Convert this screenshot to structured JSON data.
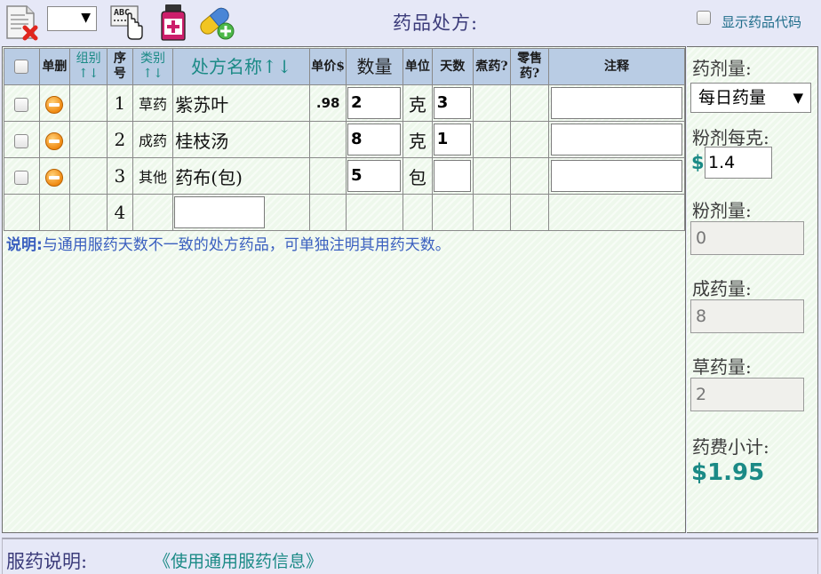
{
  "toolbar": {
    "select_value": "",
    "title": "药品处方:",
    "show_code_label": "显示药品代码",
    "icons": [
      "clear-prescription-icon",
      "spell-check-icon",
      "medicine-bottle-icon",
      "add-capsule-icon"
    ]
  },
  "table": {
    "headers": {
      "delete": "单删",
      "group": "组别↑↓",
      "seq": "序号",
      "category": "类别↑↓",
      "name": "处方名称↑↓",
      "price": "单价$",
      "qty": "数量",
      "unit": "单位",
      "days": "天数",
      "decoct": "煮药?",
      "retail": "零售药?",
      "notes": "注释"
    },
    "rows": [
      {
        "seq": "1",
        "category": "草药",
        "name": "紫苏叶",
        "price": ".98",
        "qty": "2",
        "unit": "克",
        "days": "3",
        "note": ""
      },
      {
        "seq": "2",
        "category": "成药",
        "name": "桂枝汤",
        "price": "",
        "qty": "8",
        "unit": "克",
        "days": "1",
        "note": ""
      },
      {
        "seq": "3",
        "category": "其他",
        "name": "药布(包)",
        "price": "",
        "qty": "5",
        "unit": "包",
        "days": "",
        "note": ""
      },
      {
        "seq": "4",
        "category": "",
        "name": "",
        "price": "",
        "qty": "",
        "unit": "",
        "days": "",
        "note": ""
      }
    ],
    "note_label": "说明:",
    "note_text": "与通用服药天数不一致的处方药品，可单独注明其用药天数。"
  },
  "side": {
    "dose_label": "药剂量:",
    "dose_value": "每日药量",
    "powder_per_gram_label": "粉剂每克:",
    "currency": "$",
    "powder_per_gram_value": "1.4",
    "powder_amount_label": "粉剂量:",
    "powder_amount_value": "0",
    "patent_amount_label": "成药量:",
    "patent_amount_value": "8",
    "herb_amount_label": "草药量:",
    "herb_amount_value": "2",
    "fee_label": "药费小计:",
    "fee_value": "$1.95"
  },
  "footer": {
    "label": "服药说明:",
    "link": "《使用通用服药信息》"
  },
  "colors": {
    "header_bg": "#b9cce4",
    "teal": "#1b8a86",
    "title": "#3b3b7a",
    "note_blue": "#3a5fbf",
    "panel_bg": "#eef8ec"
  }
}
